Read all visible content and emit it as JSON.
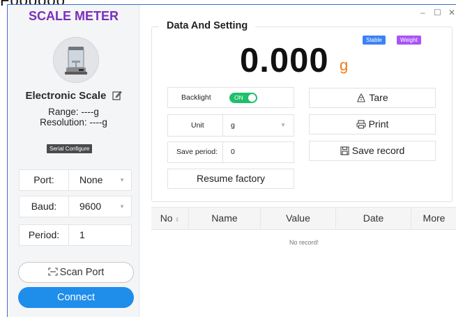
{
  "cutoff_text": "Foooooo",
  "sidebar": {
    "app_title": "SCALE METER",
    "device_name": "Electronic Scale",
    "range_text": "Range: ----g",
    "resolution_text": "Resolution: ----g",
    "serial_configure_label": "Serial Configure",
    "port": {
      "label": "Port:",
      "value": "None"
    },
    "baud": {
      "label": "Baud:",
      "value": "9600"
    },
    "period": {
      "label": "Period:",
      "value": "1"
    },
    "scan_port_label": "Scan Port",
    "connect_label": "Connect"
  },
  "window_controls": {
    "minimize": "–",
    "maximize": "☐",
    "close": "✕"
  },
  "main": {
    "section_title": "Data And Setting",
    "badges": {
      "stable": "Stable",
      "weight": "Weight"
    },
    "reading": "0.000",
    "reading_unit": "g",
    "backlight": {
      "label": "Backlight",
      "toggle_text": "ON",
      "state": true
    },
    "unit": {
      "label": "Unit",
      "value": "g"
    },
    "save_period": {
      "label": "Save period:",
      "value": "0"
    },
    "tare_label": "Tare",
    "print_label": "Print",
    "save_record_label": "Save record",
    "resume_factory_label": "Resume factory"
  },
  "table": {
    "columns": [
      "No",
      "Name",
      "Value",
      "Date",
      "More"
    ],
    "empty_text": "No record!"
  },
  "colors": {
    "app_title": "#7b2fb8",
    "connect": "#1f8dea",
    "toggle_on": "#1fbf6b",
    "badge_stable": "#3b82f6",
    "badge_weight": "#a855f7",
    "unit_accent": "#f07916"
  },
  "icons": {
    "edit": "edit-icon",
    "tare": "tare-icon",
    "print": "printer-icon",
    "save": "save-icon",
    "scan": "scan-icon",
    "scale": "scale-icon"
  }
}
